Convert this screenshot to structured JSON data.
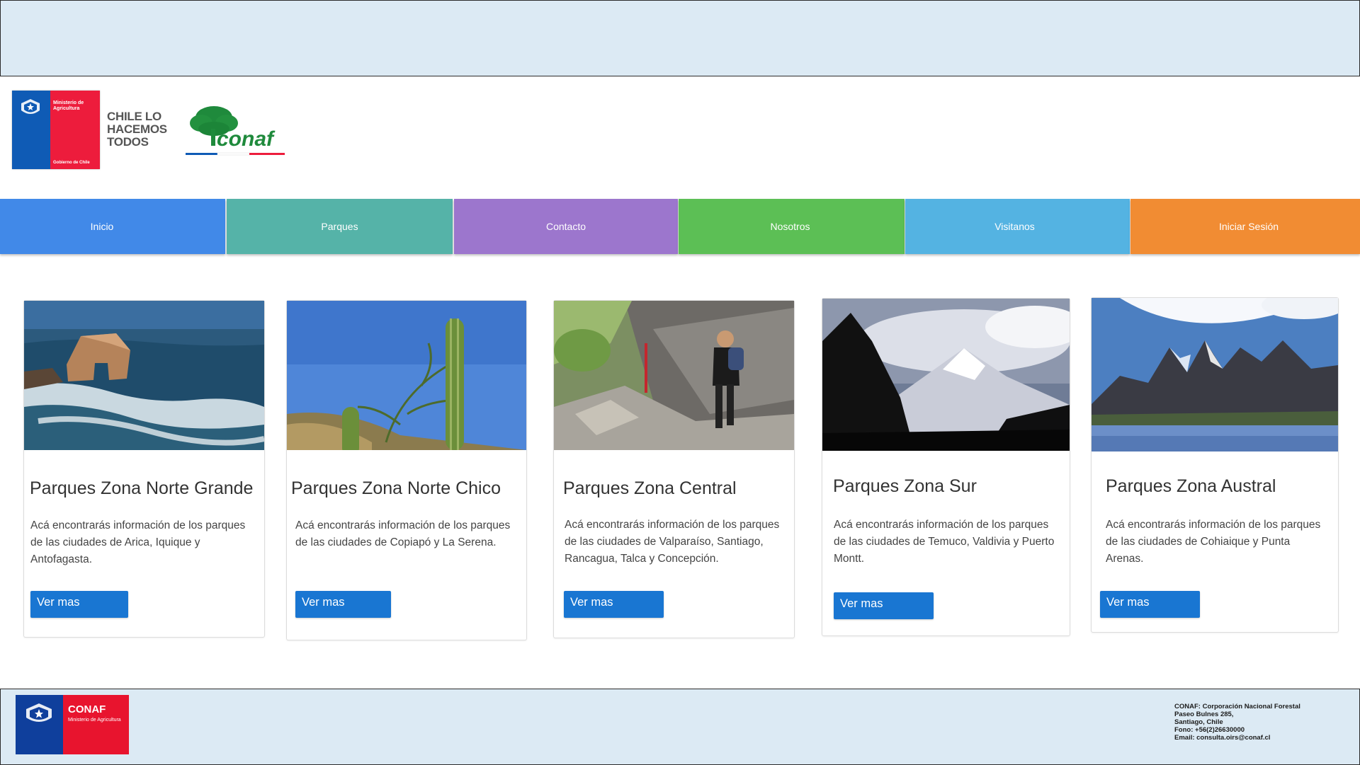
{
  "header": {
    "gov_logo": {
      "ministry": "Ministerio de Agricultura",
      "gobierno": "Gobierno de Chile"
    },
    "slogan": "CHILE LO HACEMOS TODOS",
    "conaf_logo_text": "conaf"
  },
  "nav": {
    "items": [
      {
        "label": "Inicio",
        "color": "#4189e8"
      },
      {
        "label": "Parques",
        "color": "#55b3a8"
      },
      {
        "label": "Contacto",
        "color": "#9c76cd"
      },
      {
        "label": "Nosotros",
        "color": "#5cbf55"
      },
      {
        "label": "Visitanos",
        "color": "#54b3e2"
      },
      {
        "label": "Iniciar Sesión",
        "color": "#f18c33"
      }
    ]
  },
  "cards": [
    {
      "title": "Parques Zona Norte Grande",
      "text": "Acá encontrarás información de los parques de las ciudades de Arica, Iquique y Antofagasta.",
      "button": "Ver mas",
      "image": "coastal-rock-arch-ocean"
    },
    {
      "title": "Parques Zona Norte Chico",
      "text": "Acá encontrarás información de los parques de las ciudades de Copiapó y La Serena.",
      "button": "Ver mas",
      "image": "cactus-blue-sky"
    },
    {
      "title": "Parques Zona Central",
      "text": "Acá encontrarás información de los parques de las ciudades de Valparaíso, Santiago, Rancagua, Talca y Concepción.",
      "button": "Ver mas",
      "image": "hiker-rocky-trail"
    },
    {
      "title": "Parques Zona Sur",
      "text": "Acá encontrarás información de los parques de las ciudades de Temuco, Valdivia y Puerto Montt.",
      "button": "Ver mas",
      "image": "snowy-volcano"
    },
    {
      "title": "Parques Zona Austral",
      "text": "Acá encontrarás información de los parques de las ciudades de Cohiaique y Punta Arenas.",
      "button": "Ver mas",
      "image": "mountain-lake-torres"
    }
  ],
  "footer": {
    "logo": {
      "name": "CONAF",
      "sub": "Ministerio de Agricultura"
    },
    "info": [
      "CONAF: Corporación Nacional Forestal",
      "Paseo Bulnes 285,",
      "Santiago, Chile",
      "Fono: +56(2)26630000",
      "Email: consulta.oirs@conaf.cl"
    ]
  }
}
